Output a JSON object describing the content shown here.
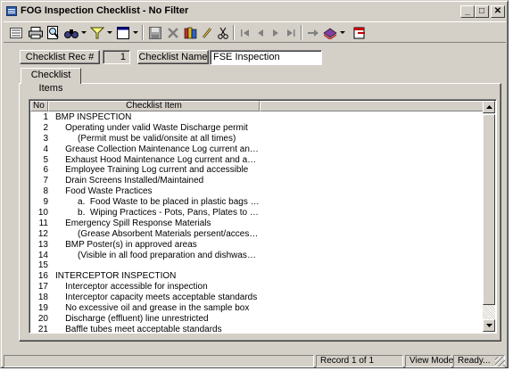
{
  "window": {
    "title": "FOG Inspection Checklist - No Filter",
    "minimize": "_",
    "maximize": "□",
    "close": "✕"
  },
  "toolbar": {
    "icons": [
      "list-icon",
      "print-icon",
      "print-preview-icon",
      "find-icon",
      "filter-icon",
      "view-icon",
      "save-icon",
      "delete-icon",
      "books-icon",
      "edit-icon",
      "cut-icon",
      "first-record-icon",
      "previous-record-icon",
      "next-record-icon",
      "last-record-icon",
      "new-record-icon",
      "reports-icon",
      "exit-icon"
    ]
  },
  "form": {
    "rec_button": "Checklist Rec #",
    "rec_value": "1",
    "name_button": "Checklist Name",
    "name_value": "FSE Inspection"
  },
  "tab": {
    "label": "Checklist Items"
  },
  "grid": {
    "headers": {
      "no": "No",
      "item": "Checklist Item"
    },
    "rows": [
      {
        "no": "1",
        "item": "BMP INSPECTION"
      },
      {
        "no": "2",
        "item": "    Operating under valid Waste Discharge permit"
      },
      {
        "no": "3",
        "item": "         (Permit must be valid/onsite at all times)"
      },
      {
        "no": "4",
        "item": "    Grease Collection Maintenance Log current and accessible"
      },
      {
        "no": "5",
        "item": "    Exhaust Hood Maintenance Log current and accessible"
      },
      {
        "no": "6",
        "item": "    Employee Training Log current and accessible"
      },
      {
        "no": "7",
        "item": "    Drain Screens Installed/Maintained"
      },
      {
        "no": "8",
        "item": "    Food Waste Practices"
      },
      {
        "no": "9",
        "item": "         a.  Food Waste to be placed in plastic bags or trash, not..."
      },
      {
        "no": "10",
        "item": "         b.  Wiping Practices - Pots, Pans, Plates to be Dry Wipe..."
      },
      {
        "no": "11",
        "item": "    Emergency Spill Response Materials"
      },
      {
        "no": "12",
        "item": "         (Grease Absorbent Materials persent/accessible in eve..."
      },
      {
        "no": "13",
        "item": "    BMP Poster(s) in approved areas"
      },
      {
        "no": "14",
        "item": "         (Visible in all food preparation and dishwashing areas)"
      },
      {
        "no": "15",
        "item": ""
      },
      {
        "no": "16",
        "item": "INTERCEPTOR INSPECTION"
      },
      {
        "no": "17",
        "item": "    Interceptor accessible for inspection"
      },
      {
        "no": "18",
        "item": "    Interceptor capacity meets acceptable standards"
      },
      {
        "no": "19",
        "item": "    No excessive oil and grease in the sample box"
      },
      {
        "no": "20",
        "item": "    Discharge (effluent) line unrestricted"
      },
      {
        "no": "21",
        "item": "    Baffle tubes meet acceptable standards"
      }
    ]
  },
  "status": {
    "record": "Record 1 of 1",
    "mode": "View Mode",
    "state": "Ready..."
  }
}
